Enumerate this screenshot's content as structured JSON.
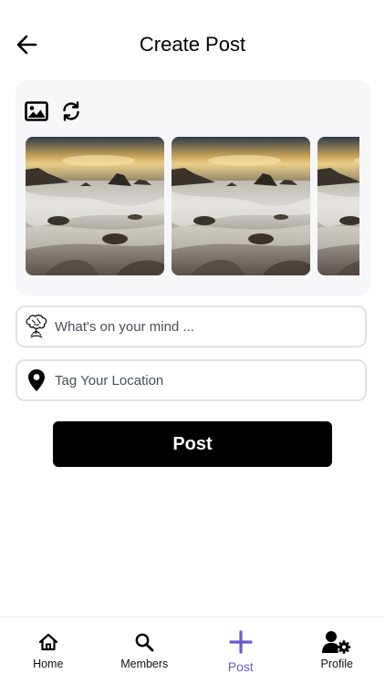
{
  "header": {
    "title": "Create Post",
    "back_icon": "arrow-left-icon"
  },
  "media": {
    "tools": [
      {
        "icon": "image-icon"
      },
      {
        "icon": "refresh-icon"
      }
    ],
    "thumbnails": [
      {
        "icon": "seascape-photo"
      },
      {
        "icon": "seascape-photo"
      },
      {
        "icon": "seascape-photo"
      }
    ]
  },
  "form": {
    "mind": {
      "placeholder": "What's on your mind ...",
      "value": "",
      "icon": "brain-tree-icon"
    },
    "location": {
      "placeholder": "Tag Your Location",
      "value": "",
      "icon": "location-pin-icon"
    },
    "post_label": "Post"
  },
  "tabbar": {
    "active_color": "#6a5acd",
    "tabs": [
      {
        "label": "Home",
        "icon": "home-icon"
      },
      {
        "label": "Members",
        "icon": "search-icon"
      },
      {
        "label": "Post",
        "icon": "plus-icon"
      },
      {
        "label": "Profile",
        "icon": "user-settings-icon"
      }
    ]
  }
}
